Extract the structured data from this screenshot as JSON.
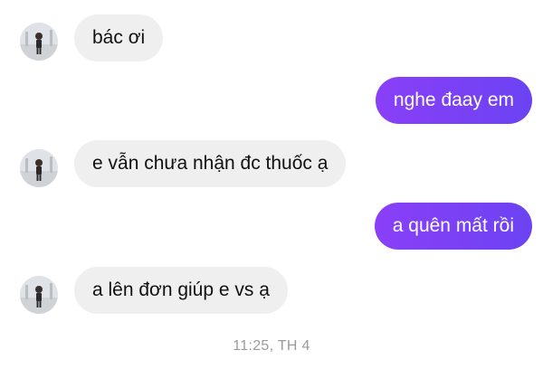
{
  "messages": [
    {
      "sender": "other",
      "text": "bác ơi",
      "has_avatar": true
    },
    {
      "sender": "self",
      "text": "nghe đaay em"
    },
    {
      "sender": "other",
      "text": "e vẫn chưa nhận đc thuốc ạ",
      "has_avatar": true
    },
    {
      "sender": "self",
      "text": "a quên mất rồi"
    },
    {
      "sender": "other",
      "text": "a lên đơn giúp e vs ạ",
      "has_avatar": true
    }
  ],
  "timestamp": "11:25, TH 4",
  "colors": {
    "outgoing_start": "#8a3ff8",
    "outgoing_end": "#6b43f2",
    "incoming": "#efefef",
    "background": "#ffffff"
  },
  "avatar_icon": "profile-photo-icon"
}
